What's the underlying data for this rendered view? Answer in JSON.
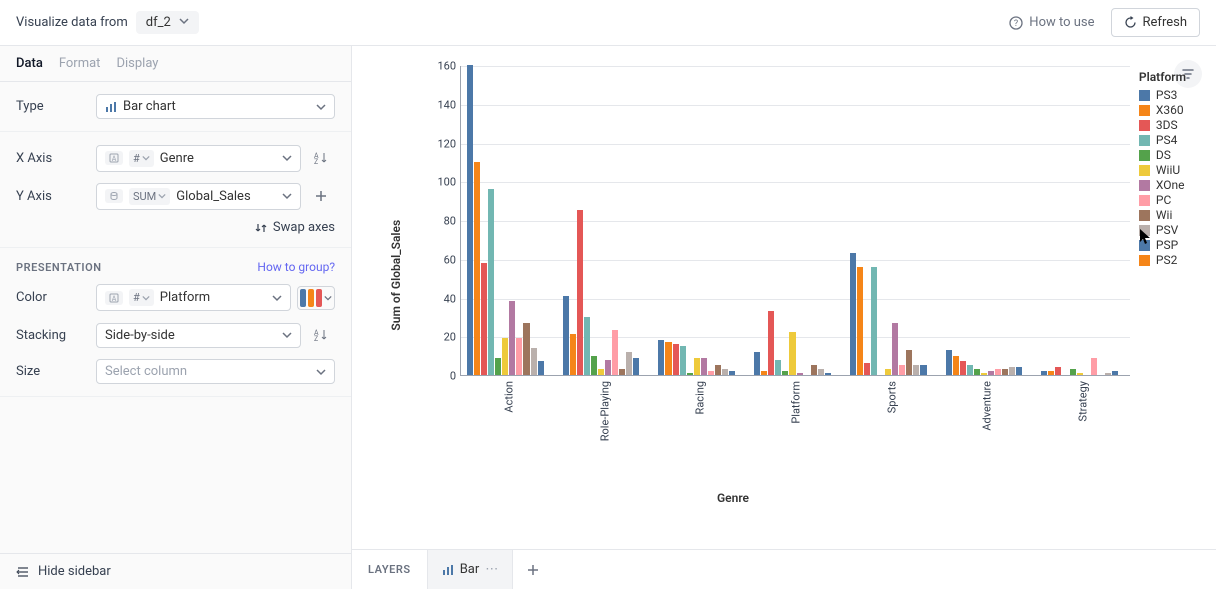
{
  "topbar": {
    "label": "Visualize data from",
    "dataframe": "df_2",
    "howto": "How to use",
    "refresh": "Refresh"
  },
  "tabs": [
    "Data",
    "Format",
    "Display"
  ],
  "active_tab": 0,
  "type_row": {
    "label": "Type",
    "value": "Bar chart"
  },
  "xaxis": {
    "label": "X Axis",
    "field": "Genre",
    "type_code": "#"
  },
  "yaxis": {
    "label": "Y Axis",
    "agg": "SUM",
    "field": "Global_Sales"
  },
  "swap": "Swap axes",
  "presentation": {
    "heading": "PRESENTATION",
    "group_link": "How to group?",
    "color": {
      "label": "Color",
      "type_code": "#",
      "field": "Platform"
    },
    "stacking": {
      "label": "Stacking",
      "value": "Side-by-side"
    },
    "size": {
      "label": "Size",
      "placeholder": "Select column"
    }
  },
  "hide_sidebar": "Hide sidebar",
  "layers": {
    "label": "LAYERS",
    "tab": "Bar"
  },
  "legend_title": "Platform",
  "chart_data": {
    "type": "bar",
    "xlabel": "Genre",
    "ylabel": "Sum of Global_Sales",
    "ylim": [
      0,
      160
    ],
    "yticks": [
      0,
      20,
      40,
      60,
      80,
      100,
      120,
      140,
      160
    ],
    "categories": [
      "Action",
      "Role-Playing",
      "Racing",
      "Platform",
      "Sports",
      "Adventure",
      "Strategy"
    ],
    "series": [
      {
        "name": "PS3",
        "color": "#4c78a8",
        "values": [
          160,
          41,
          18,
          12,
          63,
          13,
          2
        ]
      },
      {
        "name": "X360",
        "color": "#f58518",
        "values": [
          110,
          21,
          17,
          2,
          56,
          10,
          2
        ]
      },
      {
        "name": "3DS",
        "color": "#e45756",
        "values": [
          58,
          85,
          16,
          33,
          6,
          7,
          4
        ]
      },
      {
        "name": "PS4",
        "color": "#72b7b2",
        "values": [
          96,
          30,
          15,
          8,
          56,
          5,
          0
        ]
      },
      {
        "name": "DS",
        "color": "#54a24b",
        "values": [
          9,
          10,
          1,
          2,
          0,
          3,
          3
        ]
      },
      {
        "name": "WiiU",
        "color": "#eeca3b",
        "values": [
          19,
          3,
          9,
          22,
          3,
          1,
          1
        ]
      },
      {
        "name": "XOne",
        "color": "#b279a2",
        "values": [
          38,
          8,
          9,
          1,
          27,
          2,
          0
        ]
      },
      {
        "name": "PC",
        "color": "#ff9da6",
        "values": [
          19,
          23,
          2,
          0,
          5,
          3,
          9
        ]
      },
      {
        "name": "Wii",
        "color": "#9d755d",
        "values": [
          27,
          3,
          5,
          5,
          13,
          3,
          0
        ]
      },
      {
        "name": "PSV",
        "color": "#bab0ac",
        "values": [
          14,
          12,
          3,
          3,
          5,
          4,
          1
        ]
      },
      {
        "name": "PSP",
        "color": "#4c78a8",
        "values": [
          7,
          9,
          2,
          1,
          5,
          4,
          2
        ]
      },
      {
        "name": "PS2",
        "color": "#f58518",
        "values": [
          0,
          0,
          0,
          0,
          0,
          0,
          0
        ]
      }
    ]
  }
}
